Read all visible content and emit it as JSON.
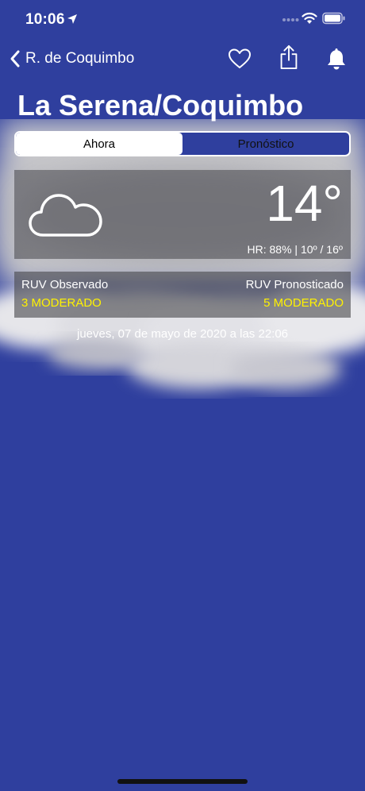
{
  "status_bar": {
    "time": "10:06"
  },
  "nav": {
    "back_label": "R. de Coquimbo"
  },
  "city": {
    "title": "La Serena/Coquimbo"
  },
  "tabs": [
    {
      "label": "Ahora",
      "active": true
    },
    {
      "label": "Pronóstico",
      "active": false
    }
  ],
  "current": {
    "temperature": "14°",
    "details": "HR: 88% | 10º / 16º",
    "condition_icon": "cloud-icon"
  },
  "uv": {
    "observed_label": "RUV Observado",
    "observed_value": "3 MODERADO",
    "forecast_label": "RUV Pronosticado",
    "forecast_value": "5 MODERADO"
  },
  "timestamp": "jueves, 07 de mayo de 2020 a las 22:06",
  "colors": {
    "background": "#2f3f9e",
    "uv_value": "#fff200",
    "text": "#ffffff"
  }
}
